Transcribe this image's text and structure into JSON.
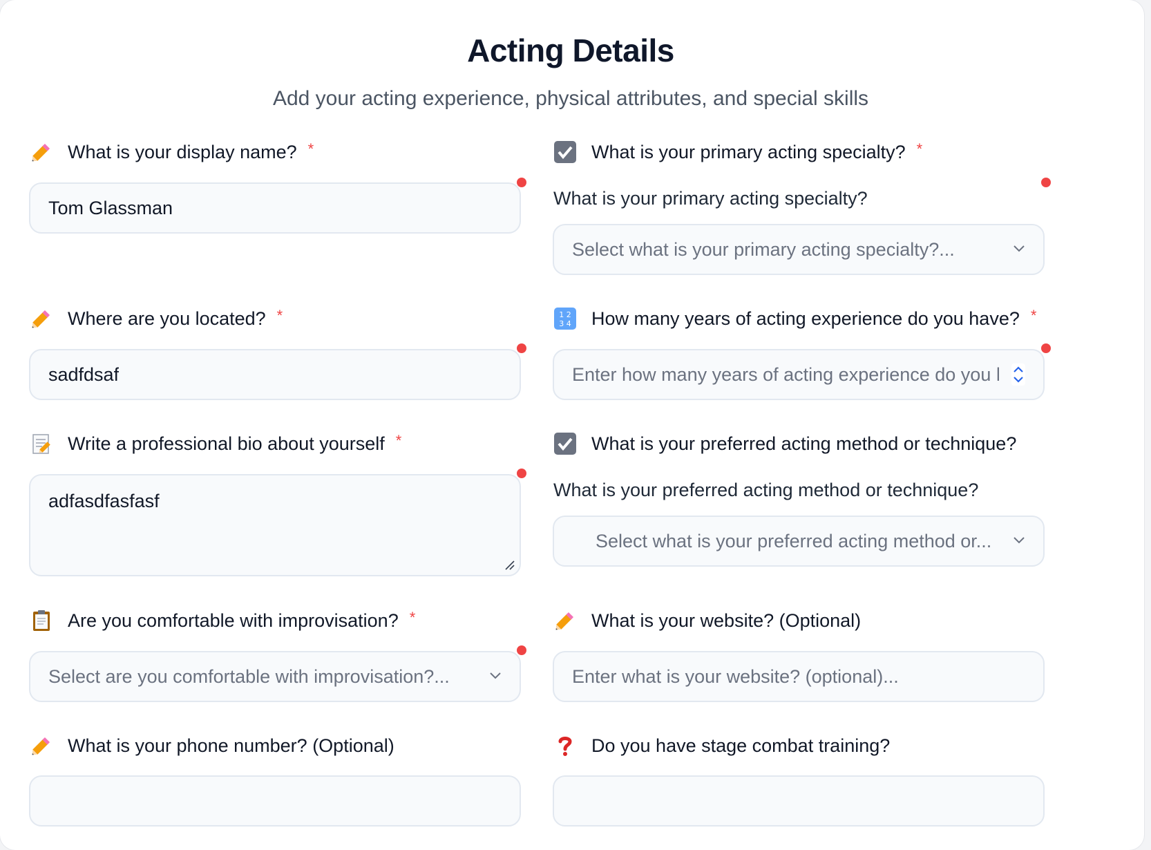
{
  "header": {
    "title": "Acting Details",
    "subtitle": "Add your acting experience, physical attributes, and special skills"
  },
  "required_mark": "*",
  "left": {
    "display_name": {
      "label": "What is your display name?",
      "icon": "pencil-icon",
      "value": "Tom Glassman"
    },
    "location": {
      "label": "Where are you located?",
      "icon": "pencil-icon",
      "value": "sadfdsaf"
    },
    "bio": {
      "label": "Write a professional bio about yourself",
      "icon": "memo-icon",
      "value": "adfasdfasfasf"
    },
    "improvisation": {
      "label": "Are you comfortable with improvisation?",
      "icon": "clipboard-icon",
      "placeholder": "Select are you comfortable with improvisation?..."
    },
    "phone": {
      "label": "What is your phone number? (Optional)",
      "icon": "pencil-icon"
    }
  },
  "right": {
    "specialty": {
      "label": "What is your primary acting specialty?",
      "icon": "checkbox-icon",
      "sublabel": "What is your primary acting specialty?",
      "placeholder": "Select what is your primary acting specialty?..."
    },
    "years": {
      "label": "How many years of acting experience do you have?",
      "icon": "numbers-icon",
      "placeholder": "Enter how many years of acting experience do you have?..."
    },
    "method": {
      "label": "What is your preferred acting method or technique?",
      "icon": "checkbox-icon",
      "sublabel": "What is your preferred acting method or technique?",
      "placeholder": "Select what is your preferred acting method or..."
    },
    "website": {
      "label": "What is your website? (Optional)",
      "icon": "pencil-icon",
      "placeholder": "Enter what is your website? (optional)..."
    },
    "combat": {
      "label": "Do you have stage combat training?",
      "icon": "question-mark-icon"
    }
  },
  "colors": {
    "required": "#ef4444",
    "field_bg": "#f8fafc",
    "field_border": "#e2e8f0",
    "accent": "#2563eb"
  }
}
